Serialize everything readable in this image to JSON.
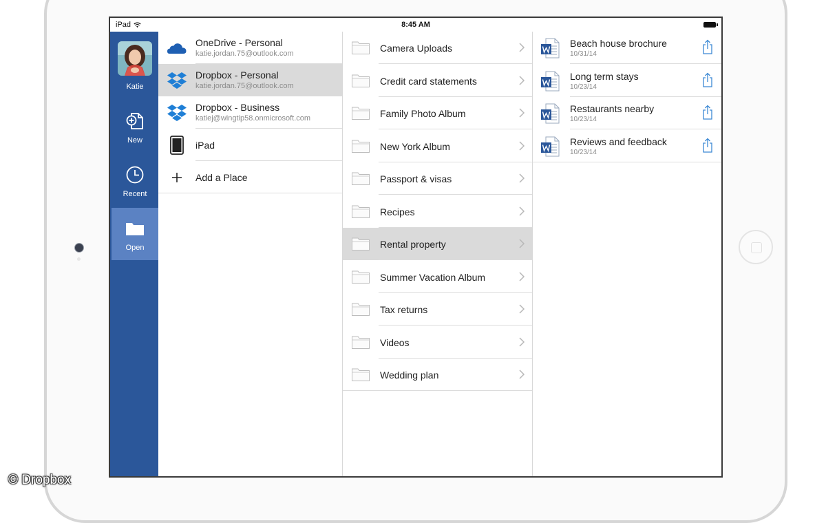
{
  "status_bar": {
    "device": "iPad",
    "time": "8:45 AM"
  },
  "nav": {
    "user_name": "Katie",
    "items": [
      {
        "label": "New",
        "icon": "new-document-icon"
      },
      {
        "label": "Recent",
        "icon": "clock-icon"
      },
      {
        "label": "Open",
        "icon": "folder-open-icon",
        "active": true
      }
    ],
    "accent_color": "#2b579a"
  },
  "places": [
    {
      "title": "OneDrive - Personal",
      "subtitle": "katie.jordan.75@outlook.com",
      "icon": "onedrive-cloud-icon"
    },
    {
      "title": "Dropbox - Personal",
      "subtitle": "katie.jordan.75@outlook.com",
      "icon": "dropbox-icon",
      "selected": true
    },
    {
      "title": "Dropbox - Business",
      "subtitle": "katiej@wingtip58.onmicrosoft.com",
      "icon": "dropbox-icon"
    },
    {
      "title": "iPad",
      "subtitle": "",
      "icon": "ipad-device-icon"
    },
    {
      "title": "Add a Place",
      "subtitle": "",
      "icon": "plus-icon"
    }
  ],
  "folders": [
    {
      "label": "Camera Uploads"
    },
    {
      "label": "Credit card statements"
    },
    {
      "label": "Family Photo Album"
    },
    {
      "label": "New York Album"
    },
    {
      "label": "Passport & visas"
    },
    {
      "label": "Recipes"
    },
    {
      "label": "Rental property",
      "selected": true
    },
    {
      "label": "Summer Vacation Album"
    },
    {
      "label": "Tax returns"
    },
    {
      "label": "Videos"
    },
    {
      "label": "Wedding plan"
    }
  ],
  "files": [
    {
      "name": "Beach house brochure",
      "date": "10/31/14"
    },
    {
      "name": "Long term stays",
      "date": "10/23/14"
    },
    {
      "name": "Restaurants nearby",
      "date": "10/23/14"
    },
    {
      "name": "Reviews and feedback",
      "date": "10/23/14"
    }
  ],
  "watermark": "© Dropbox"
}
